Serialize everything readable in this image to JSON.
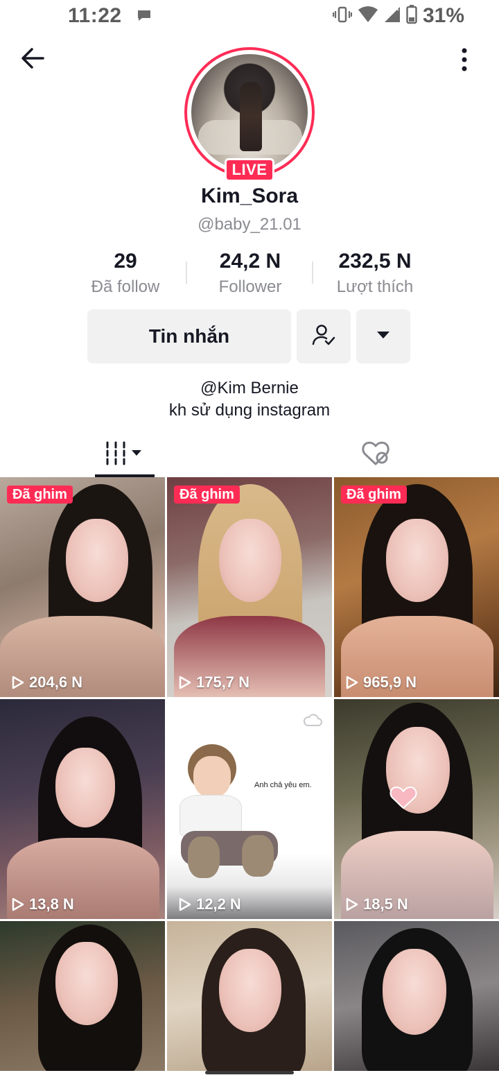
{
  "status_bar": {
    "time": "11:22",
    "battery": "31%"
  },
  "profile": {
    "live_label": "LIVE",
    "display_name": "Kim_Sora",
    "username": "@baby_21.01",
    "bio_line1": "@Kim Bernie",
    "bio_line2": "kh sử dụng instagram"
  },
  "stats": [
    {
      "value": "29",
      "label": "Đã follow"
    },
    {
      "value": "24,2 N",
      "label": "Follower"
    },
    {
      "value": "232,5 N",
      "label": "Lượt thích"
    }
  ],
  "actions": {
    "message_label": "Tin nhắn"
  },
  "tabs": {
    "active": "videos"
  },
  "videos": [
    {
      "pinned_label": "Đã ghim",
      "views": "204,6 N"
    },
    {
      "pinned_label": "Đã ghim",
      "views": "175,7 N"
    },
    {
      "pinned_label": "Đã ghim",
      "views": "965,9 N"
    },
    {
      "views": "13,8 N"
    },
    {
      "views": "12,2 N",
      "caption": "Anh chả yêu em."
    },
    {
      "views": "18,5 N"
    },
    {},
    {},
    {}
  ],
  "colors": {
    "accent": "#fe2c55",
    "text": "#161823",
    "muted": "#8a8b91",
    "button_bg": "#f1f1f2"
  }
}
